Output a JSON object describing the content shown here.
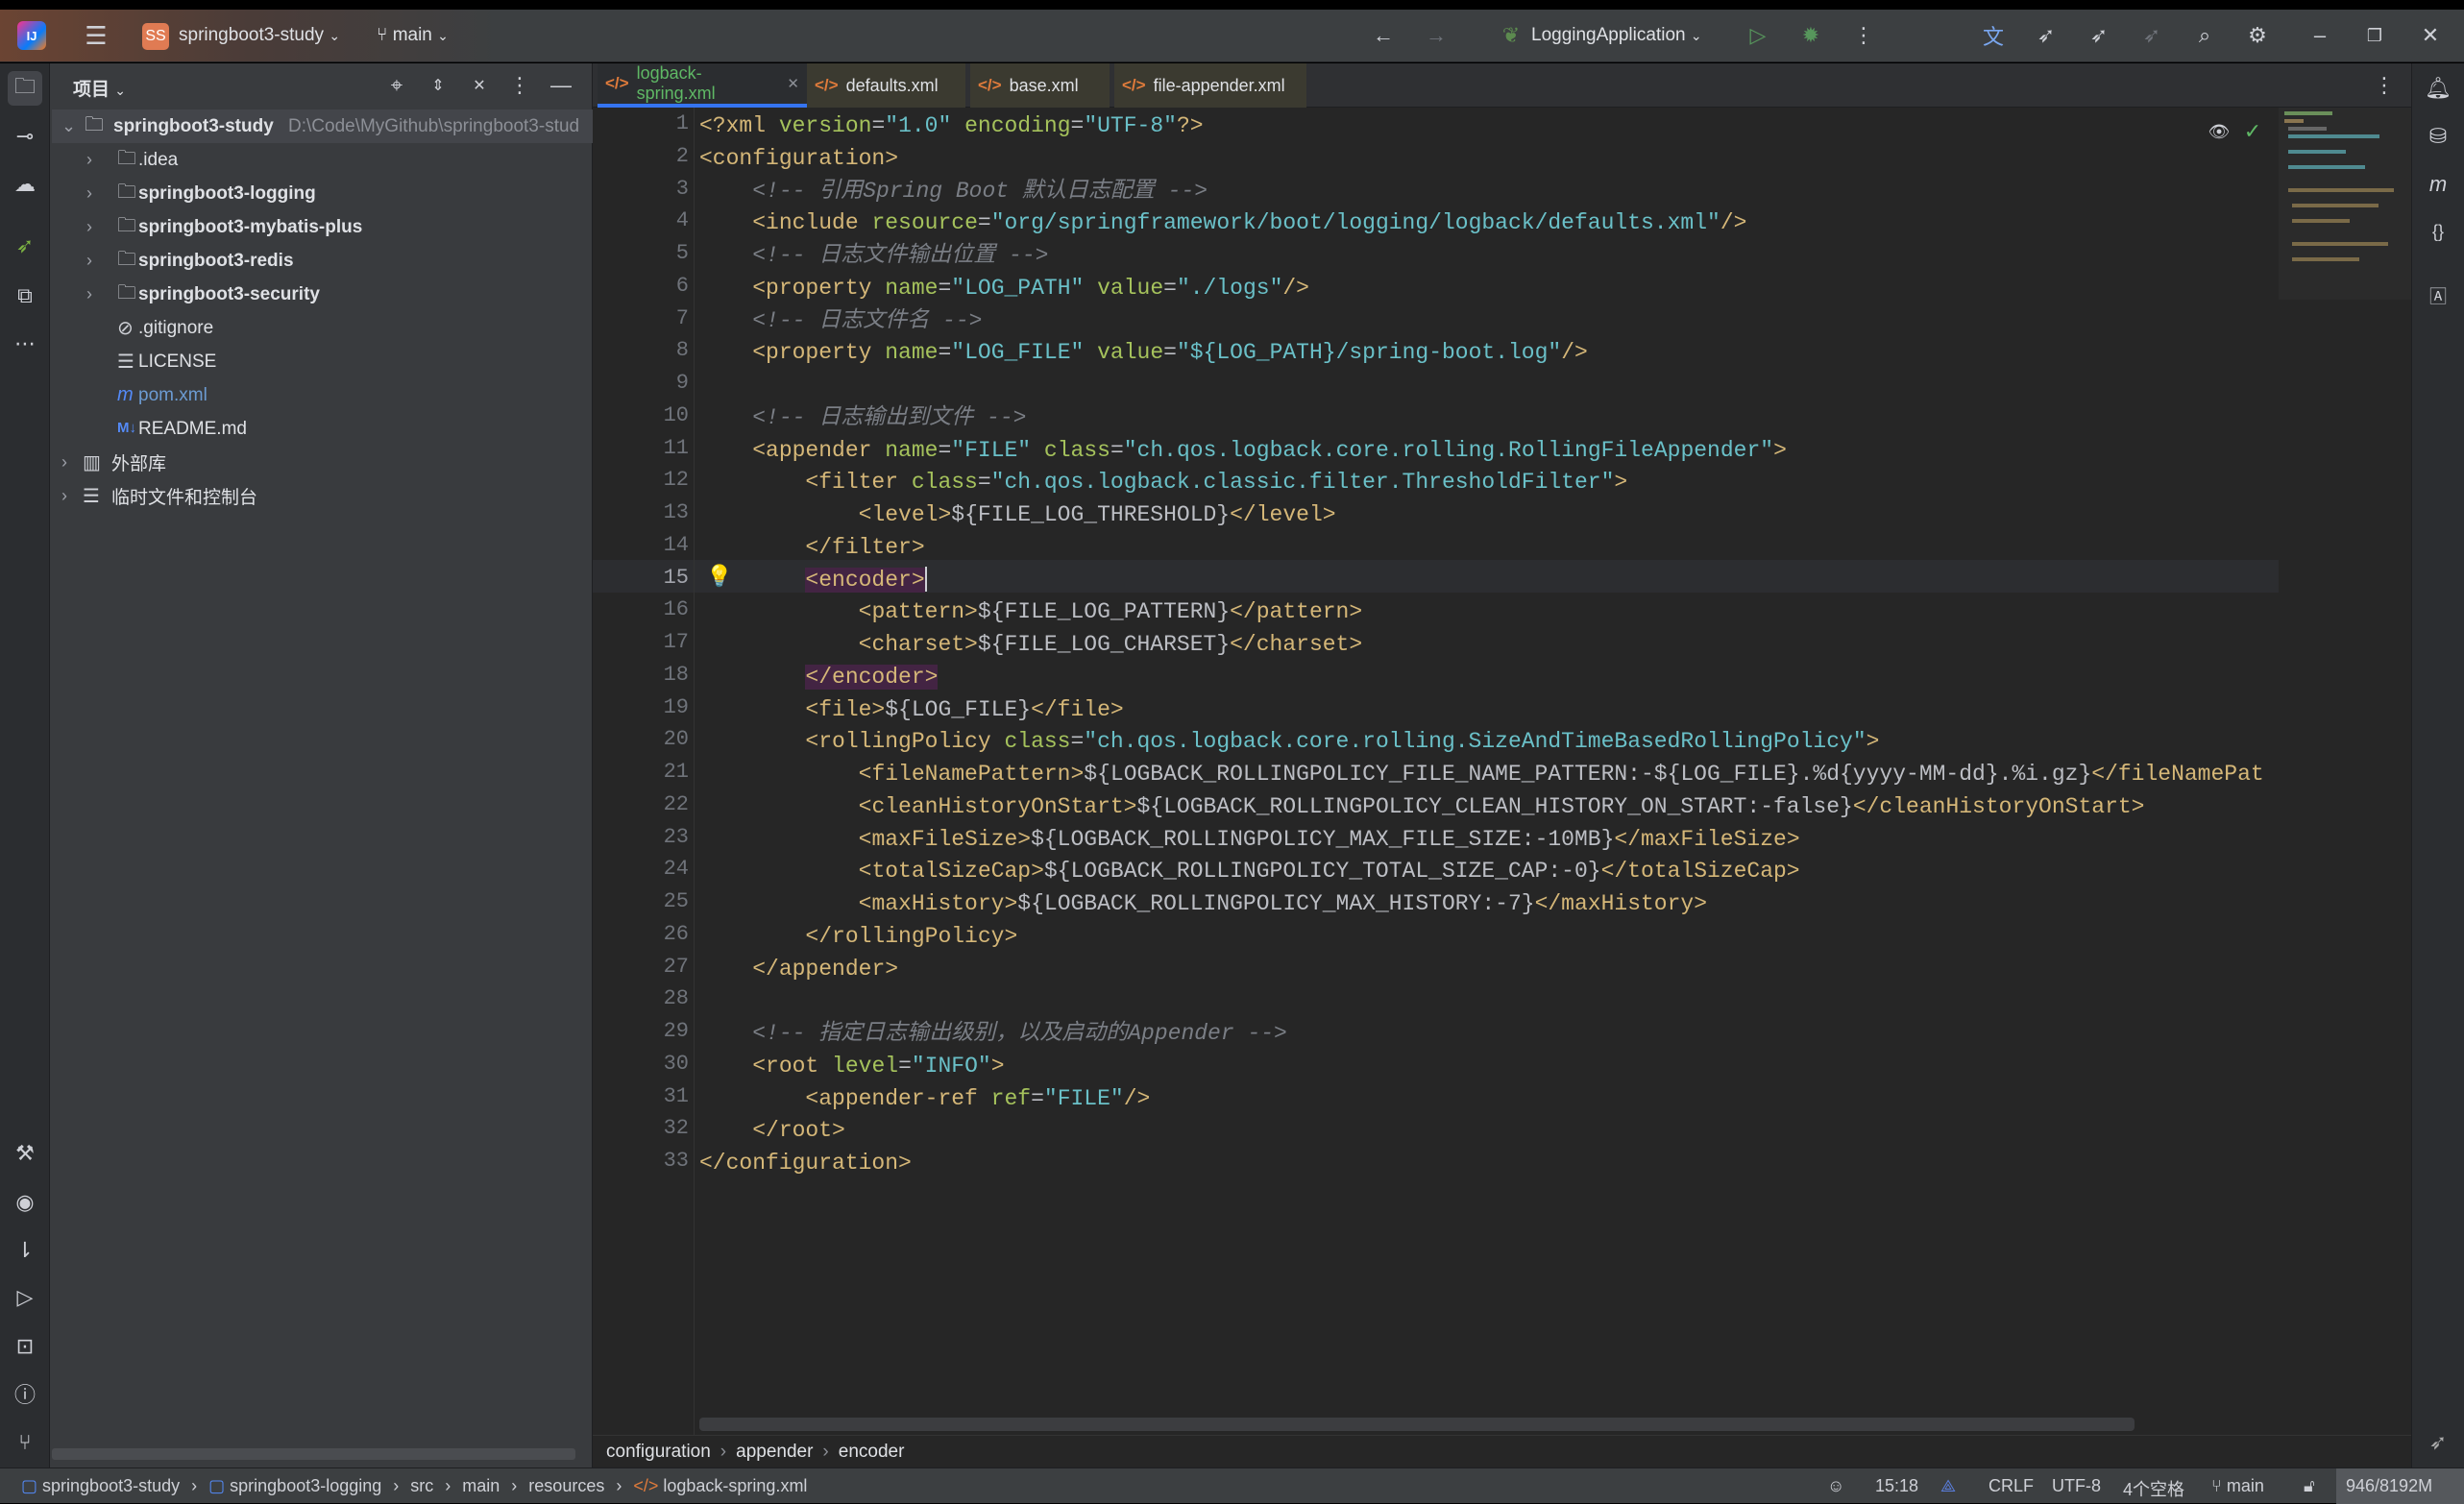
{
  "titlebar": {
    "project_badge": "SS",
    "project": "springboot3-study",
    "branch": "main",
    "run_config": "LoggingApplication"
  },
  "sidebar": {
    "title": "项目",
    "root": {
      "name": "springboot3-study",
      "path": "D:\\Code\\MyGithub\\springboot3-stud"
    },
    "items": [
      {
        "label": ".idea",
        "icon": "folder-icon",
        "bold": false,
        "chevron": true
      },
      {
        "label": "springboot3-logging",
        "icon": "module-folder-icon",
        "bold": true,
        "chevron": true
      },
      {
        "label": "springboot3-mybatis-plus",
        "icon": "module-folder-icon",
        "bold": true,
        "chevron": true
      },
      {
        "label": "springboot3-redis",
        "icon": "module-folder-icon",
        "bold": true,
        "chevron": true
      },
      {
        "label": "springboot3-security",
        "icon": "module-folder-icon",
        "bold": true,
        "chevron": true
      },
      {
        "label": ".gitignore",
        "icon": "ignore-icon",
        "bold": false,
        "chevron": false
      },
      {
        "label": "LICENSE",
        "icon": "text-file-icon",
        "bold": false,
        "chevron": false
      },
      {
        "label": "pom.xml",
        "icon": "maven-icon",
        "bold": false,
        "chevron": false
      },
      {
        "label": "README.md",
        "icon": "markdown-icon",
        "bold": false,
        "chevron": false
      }
    ],
    "external_libs": "外部库",
    "scratches": "临时文件和控制台"
  },
  "tabs": [
    {
      "label": "logback-spring.xml",
      "active": true
    },
    {
      "label": "defaults.xml"
    },
    {
      "label": "base.xml"
    },
    {
      "label": "file-appender.xml"
    }
  ],
  "editor": {
    "current_line": 15,
    "lines": [
      [
        [
          "t",
          "<?xml "
        ],
        [
          "a",
          "version"
        ],
        [
          "p",
          "="
        ],
        [
          "v",
          "\"1.0\""
        ],
        [
          "p",
          " "
        ],
        [
          "a",
          "encoding"
        ],
        [
          "p",
          "="
        ],
        [
          "v",
          "\"UTF-8\""
        ],
        [
          "t",
          "?>"
        ]
      ],
      [
        [
          "t",
          "<configuration>"
        ]
      ],
      [
        [
          "p",
          "    "
        ],
        [
          "c",
          "<!-- 引用Spring Boot 默认日志配置 -->"
        ]
      ],
      [
        [
          "p",
          "    "
        ],
        [
          "t",
          "<include "
        ],
        [
          "a",
          "resource"
        ],
        [
          "p",
          "="
        ],
        [
          "v",
          "\"org/springframework/boot/logging/logback/defaults.xml\""
        ],
        [
          "t",
          "/>"
        ]
      ],
      [
        [
          "p",
          "    "
        ],
        [
          "c",
          "<!-- 日志文件输出位置 -->"
        ]
      ],
      [
        [
          "p",
          "    "
        ],
        [
          "t",
          "<property "
        ],
        [
          "a",
          "name"
        ],
        [
          "p",
          "="
        ],
        [
          "v",
          "\"LOG_PATH\""
        ],
        [
          "p",
          " "
        ],
        [
          "a",
          "value"
        ],
        [
          "p",
          "="
        ],
        [
          "v",
          "\"./logs\""
        ],
        [
          "t",
          "/>"
        ]
      ],
      [
        [
          "p",
          "    "
        ],
        [
          "c",
          "<!-- 日志文件名 -->"
        ]
      ],
      [
        [
          "p",
          "    "
        ],
        [
          "t",
          "<property "
        ],
        [
          "a",
          "name"
        ],
        [
          "p",
          "="
        ],
        [
          "v",
          "\"LOG_FILE\""
        ],
        [
          "p",
          " "
        ],
        [
          "a",
          "value"
        ],
        [
          "p",
          "="
        ],
        [
          "v",
          "\"${LOG_PATH}/spring-boot.log\""
        ],
        [
          "t",
          "/>"
        ]
      ],
      [],
      [
        [
          "p",
          "    "
        ],
        [
          "c",
          "<!-- 日志输出到文件 -->"
        ]
      ],
      [
        [
          "p",
          "    "
        ],
        [
          "t",
          "<appender "
        ],
        [
          "a",
          "name"
        ],
        [
          "p",
          "="
        ],
        [
          "v",
          "\"FILE\""
        ],
        [
          "p",
          " "
        ],
        [
          "a",
          "class"
        ],
        [
          "p",
          "="
        ],
        [
          "v",
          "\"ch.qos.logback.core.rolling.RollingFileAppender\""
        ],
        [
          "t",
          ">"
        ]
      ],
      [
        [
          "p",
          "        "
        ],
        [
          "t",
          "<filter "
        ],
        [
          "a",
          "class"
        ],
        [
          "p",
          "="
        ],
        [
          "v",
          "\"ch.qos.logback.classic.filter.ThresholdFilter\""
        ],
        [
          "t",
          ">"
        ]
      ],
      [
        [
          "p",
          "            "
        ],
        [
          "t",
          "<level>"
        ],
        [
          "p",
          "${FILE_LOG_THRESHOLD}"
        ],
        [
          "t",
          "</level>"
        ]
      ],
      [
        [
          "p",
          "        "
        ],
        [
          "t",
          "</filter>"
        ]
      ],
      [
        [
          "p",
          "        "
        ],
        [
          "h",
          "<encoder>"
        ]
      ],
      [
        [
          "p",
          "            "
        ],
        [
          "t",
          "<pattern>"
        ],
        [
          "p",
          "${FILE_LOG_PATTERN}"
        ],
        [
          "t",
          "</pattern>"
        ]
      ],
      [
        [
          "p",
          "            "
        ],
        [
          "t",
          "<charset>"
        ],
        [
          "p",
          "${FILE_LOG_CHARSET}"
        ],
        [
          "t",
          "</charset>"
        ]
      ],
      [
        [
          "p",
          "        "
        ],
        [
          "h",
          "</encoder>"
        ]
      ],
      [
        [
          "p",
          "        "
        ],
        [
          "t",
          "<file>"
        ],
        [
          "p",
          "${LOG_FILE}"
        ],
        [
          "t",
          "</file>"
        ]
      ],
      [
        [
          "p",
          "        "
        ],
        [
          "t",
          "<rollingPolicy "
        ],
        [
          "a",
          "class"
        ],
        [
          "p",
          "="
        ],
        [
          "v",
          "\"ch.qos.logback.core.rolling.SizeAndTimeBasedRollingPolicy\""
        ],
        [
          "t",
          ">"
        ]
      ],
      [
        [
          "p",
          "            "
        ],
        [
          "t",
          "<fileNamePattern>"
        ],
        [
          "p",
          "${LOGBACK_ROLLINGPOLICY_FILE_NAME_PATTERN:-${LOG_FILE}.%d{yyyy-MM-dd}.%i.gz}"
        ],
        [
          "t",
          "</fileNamePat"
        ]
      ],
      [
        [
          "p",
          "            "
        ],
        [
          "t",
          "<cleanHistoryOnStart>"
        ],
        [
          "p",
          "${LOGBACK_ROLLINGPOLICY_CLEAN_HISTORY_ON_START:-false}"
        ],
        [
          "t",
          "</cleanHistoryOnStart>"
        ]
      ],
      [
        [
          "p",
          "            "
        ],
        [
          "t",
          "<maxFileSize>"
        ],
        [
          "p",
          "${LOGBACK_ROLLINGPOLICY_MAX_FILE_SIZE:-10MB}"
        ],
        [
          "t",
          "</maxFileSize>"
        ]
      ],
      [
        [
          "p",
          "            "
        ],
        [
          "t",
          "<totalSizeCap>"
        ],
        [
          "p",
          "${LOGBACK_ROLLINGPOLICY_TOTAL_SIZE_CAP:-0}"
        ],
        [
          "t",
          "</totalSizeCap>"
        ]
      ],
      [
        [
          "p",
          "            "
        ],
        [
          "t",
          "<maxHistory>"
        ],
        [
          "p",
          "${LOGBACK_ROLLINGPOLICY_MAX_HISTORY:-7}"
        ],
        [
          "t",
          "</maxHistory>"
        ]
      ],
      [
        [
          "p",
          "        "
        ],
        [
          "t",
          "</rollingPolicy>"
        ]
      ],
      [
        [
          "p",
          "    "
        ],
        [
          "t",
          "</appender>"
        ]
      ],
      [],
      [
        [
          "p",
          "    "
        ],
        [
          "c",
          "<!-- 指定日志输出级别，以及启动的Appender -->"
        ]
      ],
      [
        [
          "p",
          "    "
        ],
        [
          "t",
          "<root "
        ],
        [
          "a",
          "level"
        ],
        [
          "p",
          "="
        ],
        [
          "v",
          "\"INFO\""
        ],
        [
          "t",
          ">"
        ]
      ],
      [
        [
          "p",
          "        "
        ],
        [
          "t",
          "<appender-ref "
        ],
        [
          "a",
          "ref"
        ],
        [
          "p",
          "="
        ],
        [
          "v",
          "\"FILE\""
        ],
        [
          "t",
          "/>"
        ]
      ],
      [
        [
          "p",
          "    "
        ],
        [
          "t",
          "</root>"
        ]
      ],
      [
        [
          "t",
          "</configuration>"
        ]
      ]
    ]
  },
  "code_breadcrumb": [
    "configuration",
    "appender",
    "encoder"
  ],
  "statusbar": {
    "path": [
      "springboot3-study",
      "springboot3-logging",
      "src",
      "main",
      "resources",
      "logback-spring.xml"
    ],
    "position": "15:18",
    "line_ending": "CRLF",
    "encoding": "UTF-8",
    "indent": "4个空格",
    "branch": "main",
    "memory": "946/8192M"
  },
  "colors": {
    "accent": "#3574f0",
    "tag": "#d5b778",
    "attribute": "#a5c25c",
    "value": "#6ac0c8",
    "comment": "#7a7e85"
  }
}
